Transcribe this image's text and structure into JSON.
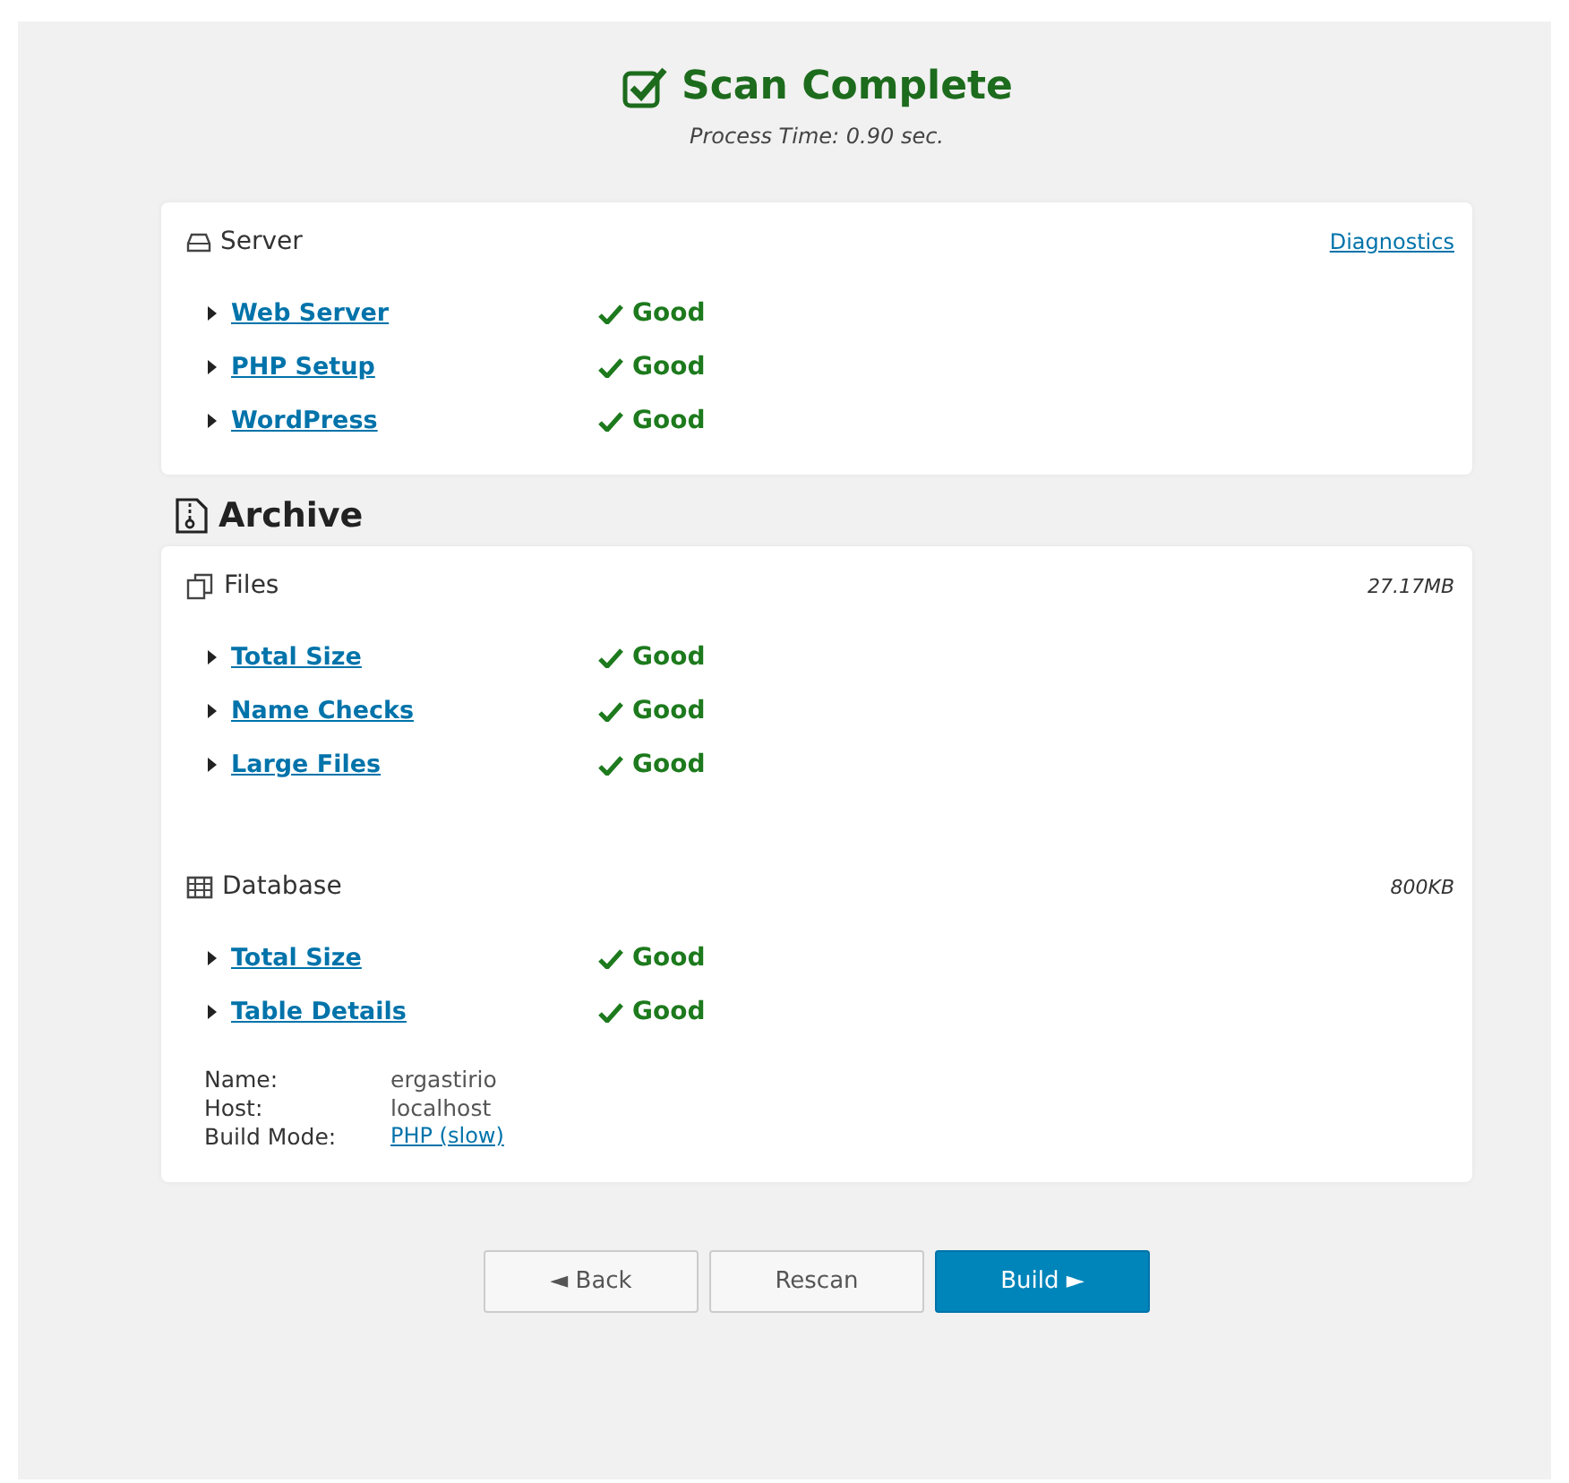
{
  "header": {
    "title": "Scan Complete",
    "subtitle": "Process Time: 0.90 sec."
  },
  "server": {
    "title": "Server",
    "link": "Diagnostics",
    "checks": [
      {
        "label": "Web Server",
        "status": "Good"
      },
      {
        "label": "PHP Setup",
        "status": "Good"
      },
      {
        "label": "WordPress",
        "status": "Good"
      }
    ]
  },
  "archive": {
    "title": "Archive",
    "sections": [
      {
        "kind": "files",
        "title": "Files",
        "size": "27.17MB",
        "checks": [
          {
            "label": "Total Size",
            "status": "Good"
          },
          {
            "label": "Name Checks",
            "status": "Good"
          },
          {
            "label": "Large Files",
            "status": "Good"
          }
        ]
      },
      {
        "kind": "database",
        "title": "Database",
        "size": "800KB",
        "checks": [
          {
            "label": "Total Size",
            "status": "Good"
          },
          {
            "label": "Table Details",
            "status": "Good"
          }
        ],
        "details": [
          {
            "label": "Name:",
            "value": "ergastirio"
          },
          {
            "label": "Host:",
            "value": "localhost"
          },
          {
            "label": "Build Mode:",
            "value": "PHP (slow)",
            "kind": "link"
          }
        ]
      }
    ]
  },
  "buttons": [
    {
      "label": "◄ Back",
      "kind": "secondary"
    },
    {
      "label": "Rescan",
      "kind": "secondary"
    },
    {
      "label": "Build ►",
      "kind": "primary"
    }
  ]
}
